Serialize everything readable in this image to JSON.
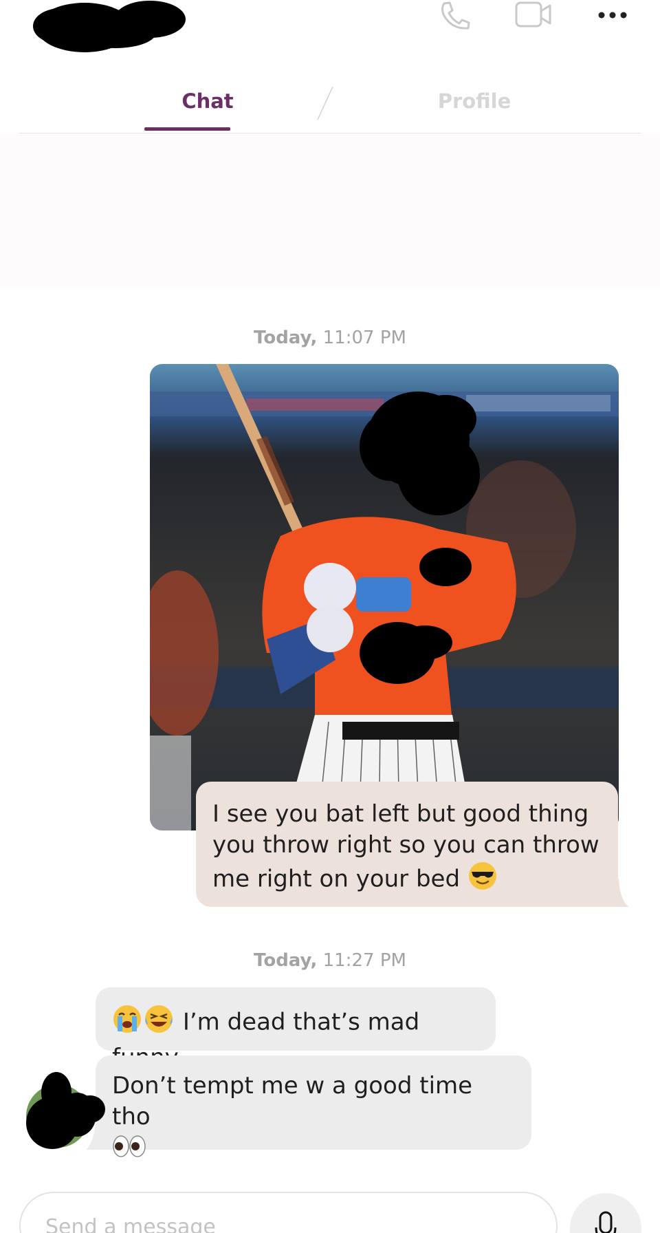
{
  "header": {
    "tabs": [
      {
        "label": "Chat",
        "active": true
      },
      {
        "label": "Profile",
        "active": false
      }
    ],
    "icons": [
      "phone-icon",
      "video-call-icon",
      "more-options-icon"
    ]
  },
  "colors": {
    "accent": "#6b2f67",
    "outgoing_bubble": "#ede1db",
    "incoming_bubble": "#ececec"
  },
  "messages": [
    {
      "timestamp_day": "Today,",
      "timestamp_time": "11:07 PM"
    },
    {
      "type": "image",
      "direction": "outgoing",
      "icon": "baseball-player-photo"
    },
    {
      "type": "text",
      "direction": "outgoing",
      "text": "I see you bat left but good thing you throw right so you can throw me right on your bed",
      "emoji": "sunglasses-emoji"
    },
    {
      "timestamp_day": "Today,",
      "timestamp_time": "11:27 PM"
    },
    {
      "type": "text",
      "direction": "incoming",
      "emoji": "crying-laughing-emojis",
      "text": "I’m dead that’s mad funny"
    },
    {
      "type": "text",
      "direction": "incoming",
      "text": "Don’t tempt me w a good time tho",
      "emoji": "eyes-emoji"
    }
  ],
  "composer": {
    "placeholder": "Send a message",
    "mic_icon": "microphone-icon"
  }
}
